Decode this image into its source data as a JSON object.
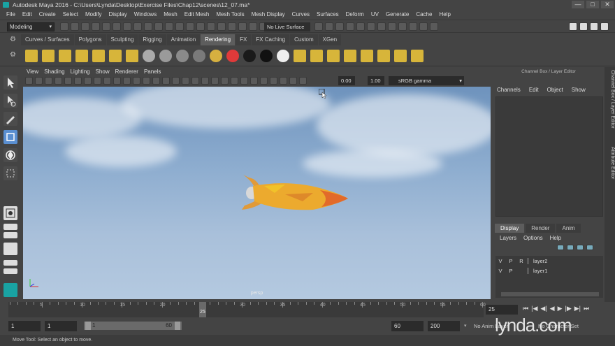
{
  "window": {
    "title": "Autodesk Maya 2016 - C:\\Users\\Lynda\\Desktop\\Exercise Files\\Chap12\\scenes\\12_07.ma*",
    "buttons": [
      "—",
      "□",
      "✕"
    ]
  },
  "menubar": {
    "items": [
      "File",
      "Edit",
      "Create",
      "Select",
      "Modify",
      "Display",
      "Windows",
      "Mesh",
      "Edit Mesh",
      "Mesh Tools",
      "Mesh Display",
      "Curves",
      "Surfaces",
      "Deform",
      "UV",
      "Generate",
      "Cache",
      "Help"
    ]
  },
  "statusline": {
    "mode": "Modeling",
    "live_surface": "No Live Surface"
  },
  "shelf": {
    "tabs": [
      "Curves / Surfaces",
      "Polygons",
      "Sculpting",
      "Rigging",
      "Animation",
      "Rendering",
      "FX",
      "FX Caching",
      "Custom",
      "XGen"
    ],
    "active_tab": "Rendering"
  },
  "viewport": {
    "menu": [
      "View",
      "Shading",
      "Lighting",
      "Show",
      "Renderer",
      "Panels"
    ],
    "near_value": "0.00",
    "far_value": "1.00",
    "color_space": "sRGB gamma",
    "camera_label": "persp"
  },
  "channel_box": {
    "title": "Channel Box / Layer Editor",
    "menu": [
      "Channels",
      "Edit",
      "Object",
      "Show"
    ]
  },
  "layer_editor": {
    "tabs": [
      "Display",
      "Render",
      "Anim"
    ],
    "active_tab": "Display",
    "menu": [
      "Layers",
      "Options",
      "Help"
    ],
    "layers": [
      {
        "v": "V",
        "p": "P",
        "r": "R",
        "name": "layer2"
      },
      {
        "v": "V",
        "p": "P",
        "r": "",
        "name": "layer1"
      }
    ]
  },
  "side_tabs": [
    "Channel Box / Layer Editor",
    "Attribute Editor"
  ],
  "timeline": {
    "ticks": [
      "5",
      "10",
      "15",
      "20",
      "25",
      "30",
      "35",
      "40",
      "45",
      "50",
      "55",
      "60"
    ],
    "current_frame": "25",
    "current_frame_field": "25"
  },
  "range": {
    "start": "1",
    "range_start": "1",
    "slider_start": "1",
    "slider_end": "60",
    "range_end": "60",
    "end": "200",
    "anim_layer": "No Anim Layer",
    "char_set": "No Character Set"
  },
  "help_line": "Move Tool: Select an object to move.",
  "watermark": "lynda.com"
}
